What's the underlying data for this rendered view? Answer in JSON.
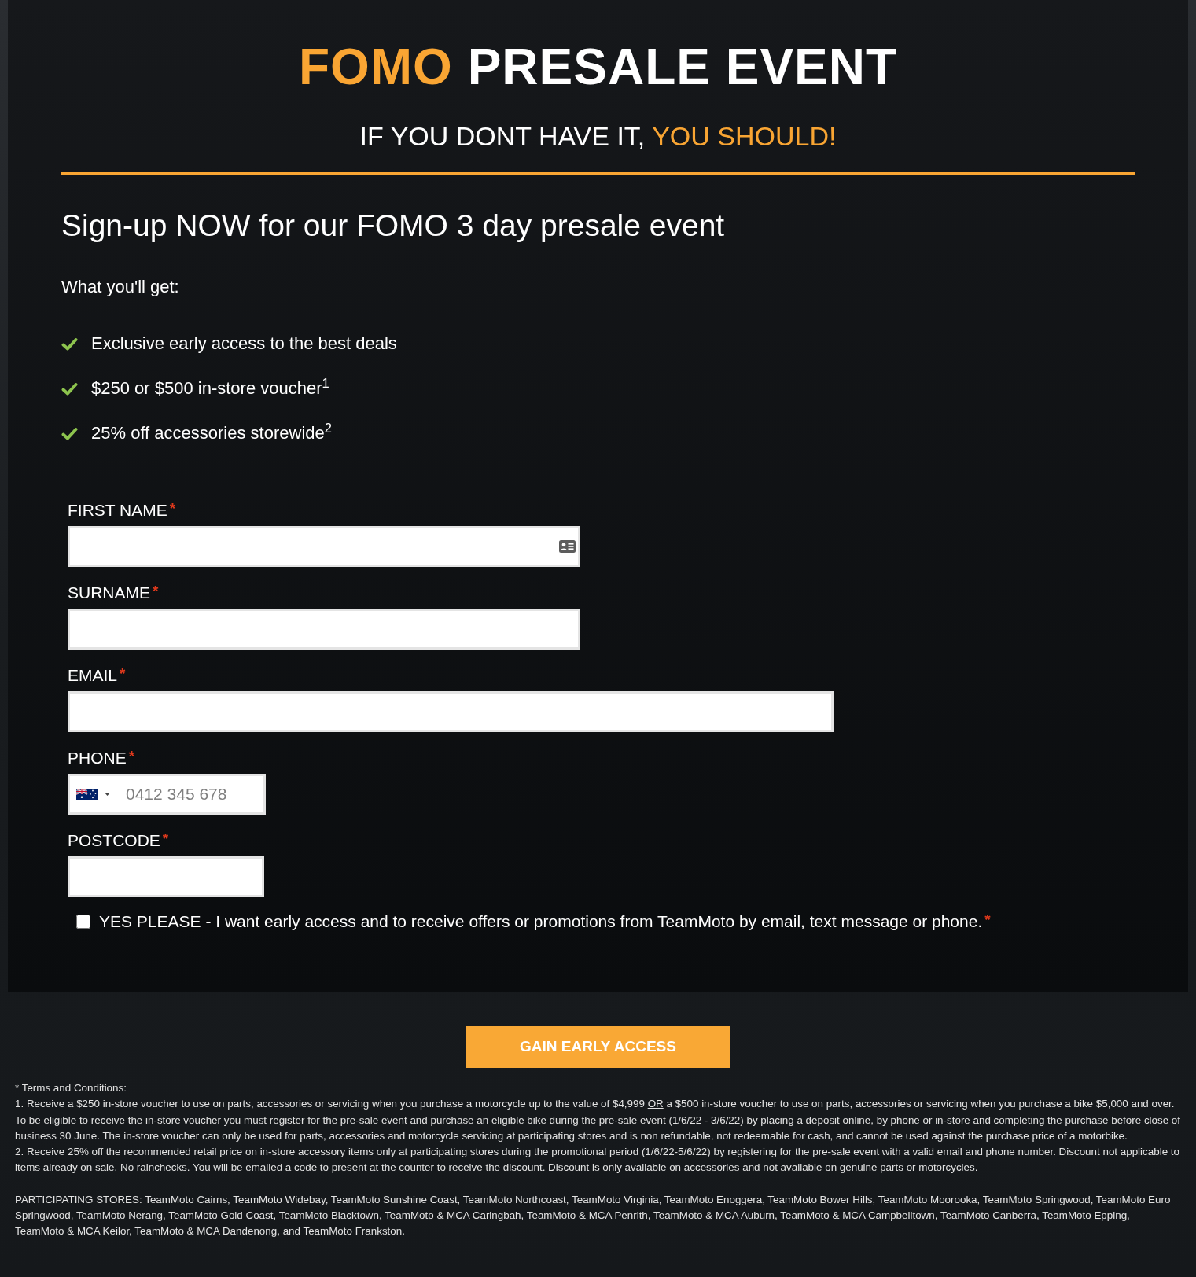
{
  "header": {
    "title": [
      {
        "text": "FOMO",
        "accent": true
      },
      {
        "text": "PRESALE EVENT",
        "accent": false
      }
    ],
    "tagline": [
      {
        "text": "IF YOU DONT HAVE IT,",
        "accent": false
      },
      {
        "text": "YOU SHOULD!",
        "accent": true
      }
    ]
  },
  "signup": {
    "heading": "Sign-up NOW for our FOMO 3 day presale event",
    "benefits_heading": "What you'll get:",
    "benefits": [
      "Exclusive early access to the best deals",
      "$250 or $500 in-store voucher$^{1}$",
      "25% off accessories storewide$^{2}$"
    ]
  },
  "form": {
    "fields": [
      {
        "kind": "name",
        "label": "FIRST NAME",
        "required_mark": "*",
        "autofill": true
      },
      {
        "kind": "name",
        "label": "SURNAME",
        "required_mark": "*",
        "autofill": false
      },
      {
        "kind": "email",
        "label": "EMAIL",
        "required_mark": "*",
        "autofill": false
      },
      {
        "kind": "phone",
        "label": "PHONE",
        "required_mark": "*",
        "autofill": false,
        "placeholder": "0412 345 678"
      },
      {
        "kind": "postcode",
        "label": "POSTCODE",
        "required_mark": "*",
        "autofill": false
      }
    ],
    "consent": {
      "label": "YES PLEASE - I want early access and to receive offers or promotions from TeamMoto by email, text message or phone.",
      "required_mark": "*",
      "checked": false
    }
  },
  "submit_button": {
    "label": "GAIN EARLY ACCESS"
  },
  "terms": {
    "heading": "* Terms and Conditions:",
    "items": [
      {
        "parts": [
          {
            "text": "1. Receive a $250 in-store voucher to use on parts, accessories or servicing when you purchase a motorcycle up to the value of $4,999 ",
            "underlined": false
          },
          {
            "text": "OR",
            "underlined": true
          },
          {
            "text": " a $500 in-store voucher to use on parts, accessories or servicing when you purchase a bike $5,000 and over. To be eligible to receive the in-store voucher you must register for the pre-sale event and purchase an eligible bike during the pre-sale event (1/6/22 - 3/6/22) by placing a deposit online, by phone or in-store and completing the purchase before close of business 30 June. The in-store voucher can only be used for parts, accessories and motorcycle servicing at participating stores and is non refundable, not redeemable for cash, and cannot be used against the purchase price of a motorbike.",
            "underlined": false
          }
        ]
      },
      {
        "parts": [
          {
            "text": "2. Receive 25% off the recommended retail price on in-store accessory items only at participating stores during the promotional period (1/6/22-5/6/22) by registering for the pre-sale event with a valid email and phone number. Discount not applicable to items already on sale. No rainchecks. You will be emailed a code to present at the counter to receive the discount. Discount is only available on accessories and not available on genuine parts or motorcycles.",
            "underlined": false
          }
        ]
      }
    ],
    "stores": "PARTICIPATING STORES: TeamMoto Cairns, TeamMoto Widebay, TeamMoto Sunshine Coast, TeamMoto Northcoast, TeamMoto Virginia, TeamMoto Enoggera, TeamMoto Bower Hills, TeamMoto Moorooka, TeamMoto Springwood, TeamMoto Euro Springwood, TeamMoto Nerang, TeamMoto Gold Coast, TeamMoto Blacktown, TeamMoto & MCA Caringbah, TeamMoto & MCA Penrith, TeamMoto & MCA Auburn, TeamMoto & MCA Campbelltown, TeamMoto Canberra, TeamMoto Epping, TeamMoto & MCA Keilor, TeamMoto & MCA Dandenong, and TeamMoto Frankston."
  }
}
